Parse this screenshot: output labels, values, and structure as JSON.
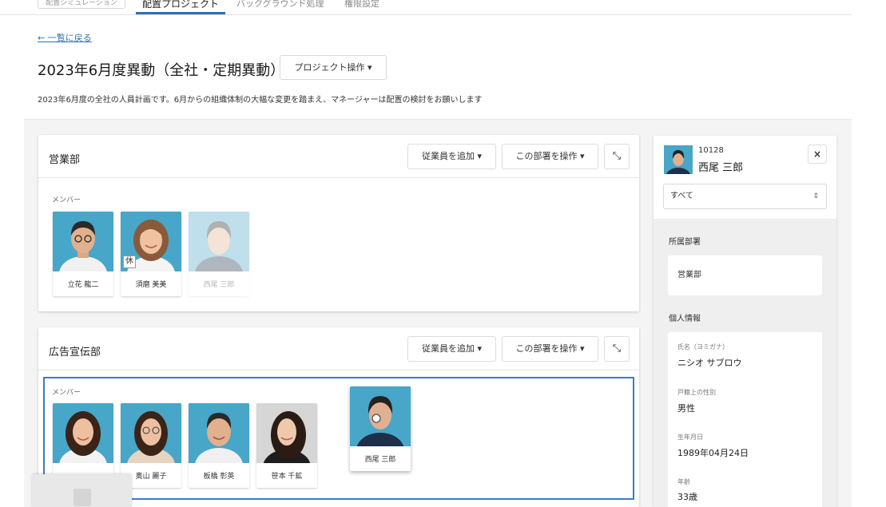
{
  "tabs": [
    {
      "label": "配置シミュレーション"
    },
    {
      "label": "配置プロジェクト"
    },
    {
      "label": "バックグラウンド処理"
    },
    {
      "label": "権限設定"
    }
  ],
  "back_link": "← 一覧に戻る",
  "project": {
    "title": "2023年6月度異動（全社・定期異動）",
    "actions_button": "プロジェクト操作 ▾",
    "description": "2023年6月度の全社の人員計画です。6月からの組織体制の大幅な変更を踏まえ、マネージャーは配置の検討をお願いします"
  },
  "departments": [
    {
      "name": "営業部",
      "add_button": "従業員を追加 ▾",
      "operate_button": "この部署を操作 ▾",
      "members_label": "メンバー",
      "members": [
        {
          "name": "立花 龍二",
          "badge": ""
        },
        {
          "name": "須磨 美美",
          "badge": "休"
        },
        {
          "name": "西尾 三郎",
          "badge": ""
        }
      ]
    },
    {
      "name": "広告宣伝部",
      "add_button": "従業員を追加 ▾",
      "operate_button": "この部署を操作 ▾",
      "members_label": "メンバー",
      "members": [
        {
          "name": "",
          "badge": ""
        },
        {
          "name": "奥山 麗子",
          "badge": ""
        },
        {
          "name": "板橋 彰英",
          "badge": ""
        },
        {
          "name": "笹本 千鉱",
          "badge": ""
        }
      ],
      "dragging": {
        "name": "西尾 三郎"
      }
    }
  ],
  "side_panel": {
    "employee_id": "10128",
    "employee_name": "西尾 三郎",
    "filter": "すべて",
    "dept_section": "所属部署",
    "dept_value": "営業部",
    "personal_section": "個人情報",
    "fields": [
      {
        "label": "氏名（ヨミガナ）",
        "value": "ニシオ サブロウ"
      },
      {
        "label": "戸籍上の性別",
        "value": "男性"
      },
      {
        "label": "生年月日",
        "value": "1989年04月24日"
      },
      {
        "label": "年齢",
        "value": "33歳"
      }
    ]
  },
  "colors": {
    "accent": "#2d6fb4",
    "photo_bg": "#48a6c8"
  }
}
